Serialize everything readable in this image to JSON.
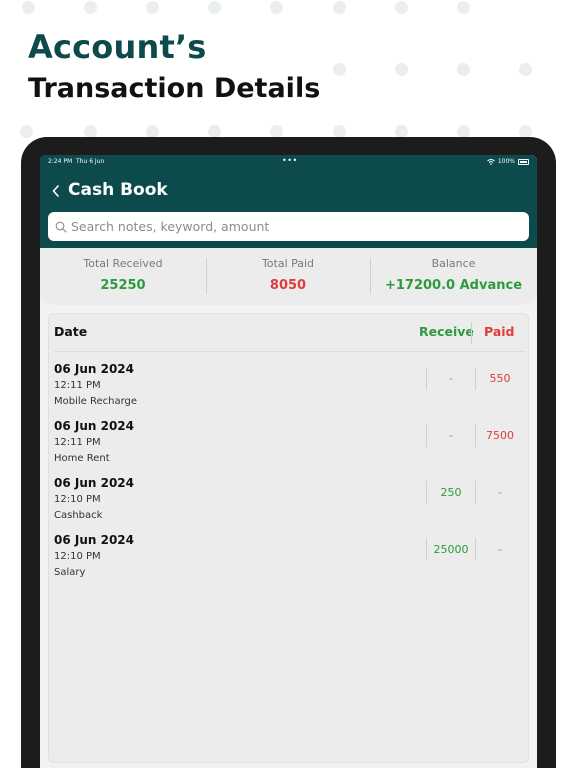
{
  "promo": {
    "headline_line1": "Account’s",
    "headline_line2": "Transaction Details"
  },
  "status_bar": {
    "time": "2:24 PM",
    "date": "Thu 6 Jun",
    "dots": "•••",
    "battery": "100%"
  },
  "header": {
    "back_icon": "‹",
    "title": "Cash Book"
  },
  "search": {
    "placeholder": "Search notes, keyword, amount",
    "value": ""
  },
  "summary": {
    "total_received_label": "Total Received",
    "total_received_value": "25250",
    "total_paid_label": "Total Paid",
    "total_paid_value": "8050",
    "balance_label": "Balance",
    "balance_value": "+17200.0 Advance"
  },
  "table": {
    "headers": {
      "date": "Date",
      "receive": "Receive",
      "paid": "Paid"
    },
    "rows": [
      {
        "date": "06 Jun 2024",
        "time": "12:11 PM",
        "note": "Mobile Recharge",
        "receive": "-",
        "paid": "550"
      },
      {
        "date": "06 Jun 2024",
        "time": "12:11 PM",
        "note": "Home Rent",
        "receive": "-",
        "paid": "7500"
      },
      {
        "date": "06 Jun 2024",
        "time": "12:10 PM",
        "note": "Cashback",
        "receive": "250",
        "paid": "-"
      },
      {
        "date": "06 Jun 2024",
        "time": "12:10 PM",
        "note": "Salary",
        "receive": "25000",
        "paid": "-"
      }
    ]
  },
  "colors": {
    "brand": "#0c4a4c",
    "receive": "#2e9a3e",
    "paid": "#e03c3c"
  }
}
